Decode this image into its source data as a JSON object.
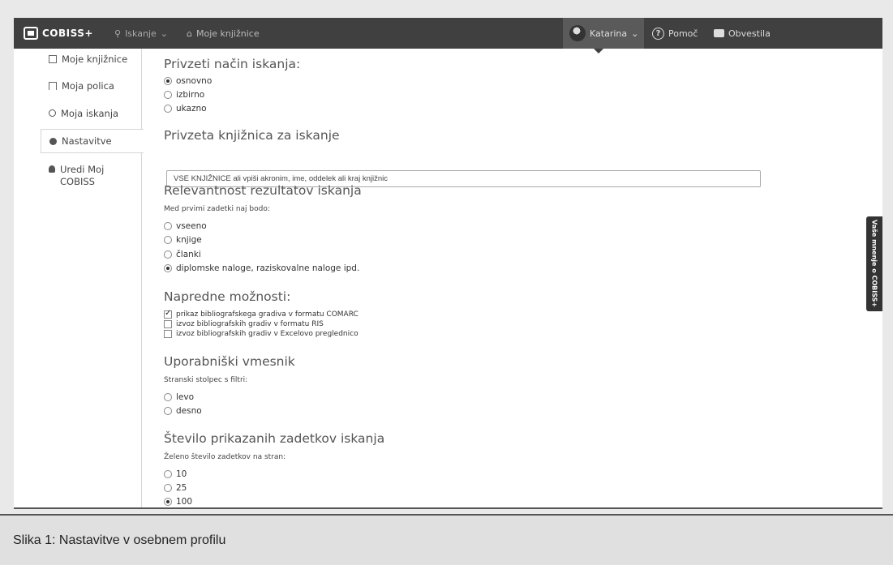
{
  "topbar": {
    "logo": "COBISS+",
    "search": "Iskanje",
    "my_libraries": "Moje knjižnice",
    "user": "Katarina",
    "help": "Pomoč",
    "news": "Obvestila"
  },
  "sidebar": {
    "items": [
      {
        "label": "Moje knjižnice",
        "icon": "list-icon"
      },
      {
        "label": "Moja polica",
        "icon": "bookmark-icon"
      },
      {
        "label": "Moja iskanja",
        "icon": "search-icon"
      },
      {
        "label": "Nastavitve",
        "icon": "gear-icon"
      },
      {
        "label": "Uredi Moj COBISS",
        "icon": "user-icon"
      }
    ]
  },
  "sections": {
    "search_mode": {
      "title": "Privzeti način iskanja:",
      "options": [
        "osnovno",
        "izbirno",
        "ukazno"
      ],
      "selected": "osnovno"
    },
    "library": {
      "title": "Privzeta knjižnica za iskanje",
      "value": "VSE KNJIŽNICE ali vpiši akronim, ime, oddelek ali kraj knjižnic"
    },
    "relevance": {
      "title": "Relevantnost rezultatov iskanja",
      "subtitle": "Med prvimi zadetki naj bodo:",
      "options": [
        "vseeno",
        "knjige",
        "članki",
        "diplomske naloge, raziskovalne naloge ipd."
      ],
      "selected": "diplomske naloge, raziskovalne naloge ipd."
    },
    "advanced": {
      "title": "Napredne možnosti:",
      "options": [
        {
          "label": "prikaz bibliografskega gradiva v formatu COMARC",
          "checked": true
        },
        {
          "label": "izvoz bibliografskih gradiv v formatu RIS",
          "checked": false
        },
        {
          "label": "izvoz bibliografskih gradiv v Excelovo preglednico",
          "checked": false
        }
      ]
    },
    "ui": {
      "title": "Uporabniški vmesnik",
      "subtitle": "Stranski stolpec s filtri:",
      "options": [
        "levo",
        "desno"
      ]
    },
    "results": {
      "title": "Število prikazanih zadetkov iskanja",
      "subtitle": "Želeno število zadetkov na stran:",
      "options": [
        "10",
        "25",
        "100"
      ],
      "selected": "100"
    }
  },
  "feedback_tab": "Vaše mnenje o COBISS+",
  "caption": "Slika 1: Nastavitve v osebnem profilu"
}
